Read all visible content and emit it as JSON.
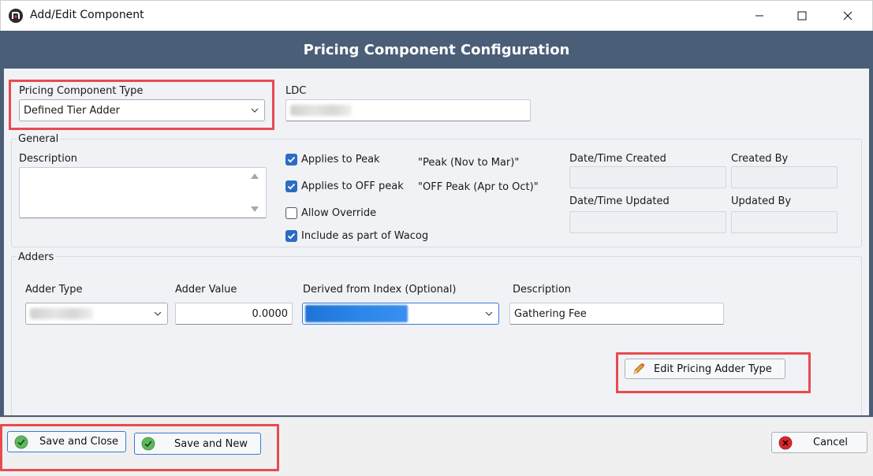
{
  "window": {
    "title": "Add/Edit Component"
  },
  "header": {
    "title": "Pricing Component Configuration"
  },
  "component_type": {
    "label": "Pricing Component Type",
    "value": "Defined Tier Adder"
  },
  "ldc": {
    "label": "LDC"
  },
  "general": {
    "label": "General",
    "description_label": "Description",
    "checkboxes": [
      {
        "label": "Applies to Peak",
        "checked": true,
        "note": "\"Peak (Nov to Mar)\""
      },
      {
        "label": "Applies to OFF peak",
        "checked": true,
        "note": "\"OFF Peak (Apr to Oct)\""
      },
      {
        "label": "Allow Override",
        "checked": false
      },
      {
        "label": "Include as part of Wacog",
        "checked": true
      }
    ],
    "created_label": "Date/Time Created",
    "created_by_label": "Created By",
    "updated_label": "Date/Time Updated",
    "updated_by_label": "Updated By"
  },
  "adders": {
    "label": "Adders",
    "adder_type_label": "Adder Type",
    "adder_value_label": "Adder Value",
    "adder_value": "0.0000",
    "derived_label": "Derived from Index (Optional)",
    "description_label": "Description",
    "description_value": "Gathering Fee",
    "edit_button": "Edit Pricing Adder Type"
  },
  "footer": {
    "save_close": "Save and Close",
    "save_new": "Save and New",
    "cancel": "Cancel"
  },
  "colors": {
    "header_bg": "#4b5e77",
    "highlight": "#e84b4f",
    "checkbox": "#2b6cc4",
    "save_icon": "#5cb85c",
    "cancel_icon": "#d9262e"
  }
}
